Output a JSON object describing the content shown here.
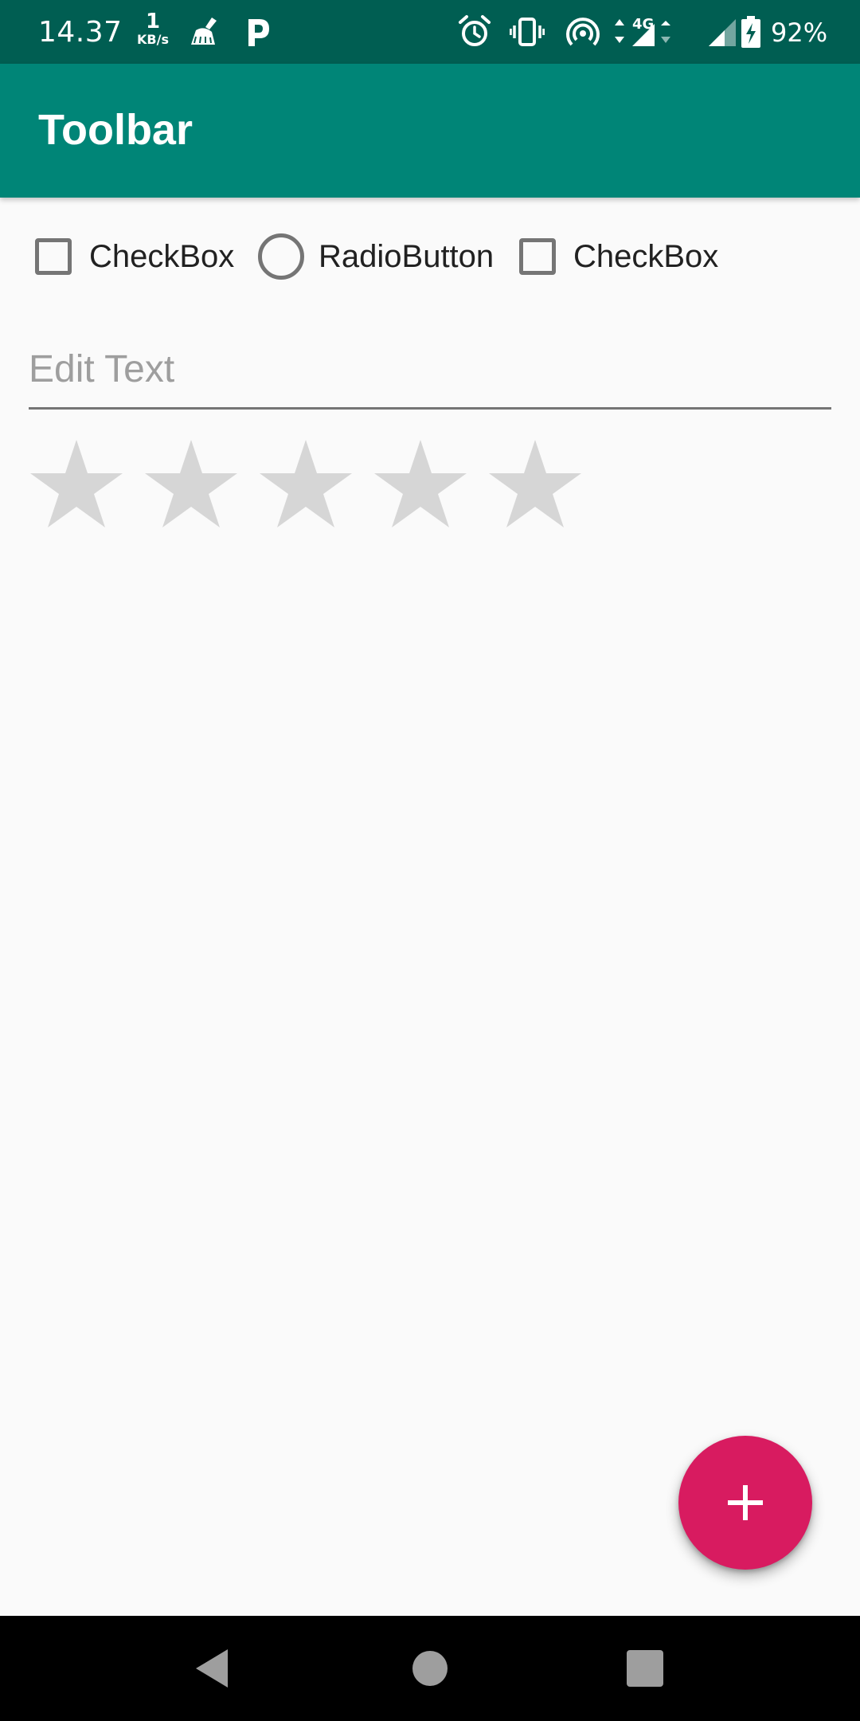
{
  "status_bar": {
    "time": "14.37",
    "net_speed_value": "1",
    "net_speed_unit": "KB/s",
    "battery_percent": "92%",
    "icons": [
      "broom-icon",
      "parking-icon",
      "alarm-icon",
      "vibrate-icon",
      "hotspot-icon",
      "data-arrows-icon",
      "signal-4g-icon",
      "signal-icon",
      "battery-charging-icon"
    ],
    "background_color": "#005e52"
  },
  "toolbar": {
    "title": "Toolbar",
    "background_color": "#008577"
  },
  "controls": {
    "checkbox_1": {
      "label": "CheckBox",
      "checked": false
    },
    "radio_1": {
      "label": "RadioButton",
      "checked": false
    },
    "checkbox_2": {
      "label": "CheckBox",
      "checked": false
    }
  },
  "edit_text": {
    "placeholder": "Edit Text",
    "value": ""
  },
  "rating": {
    "value": 0,
    "max": 5,
    "empty_color": "#d6d6d6"
  },
  "fab": {
    "icon": "plus-icon",
    "color": "#d81b60"
  },
  "nav_bar": {
    "buttons": [
      "back-icon",
      "home-icon",
      "recents-icon"
    ]
  }
}
